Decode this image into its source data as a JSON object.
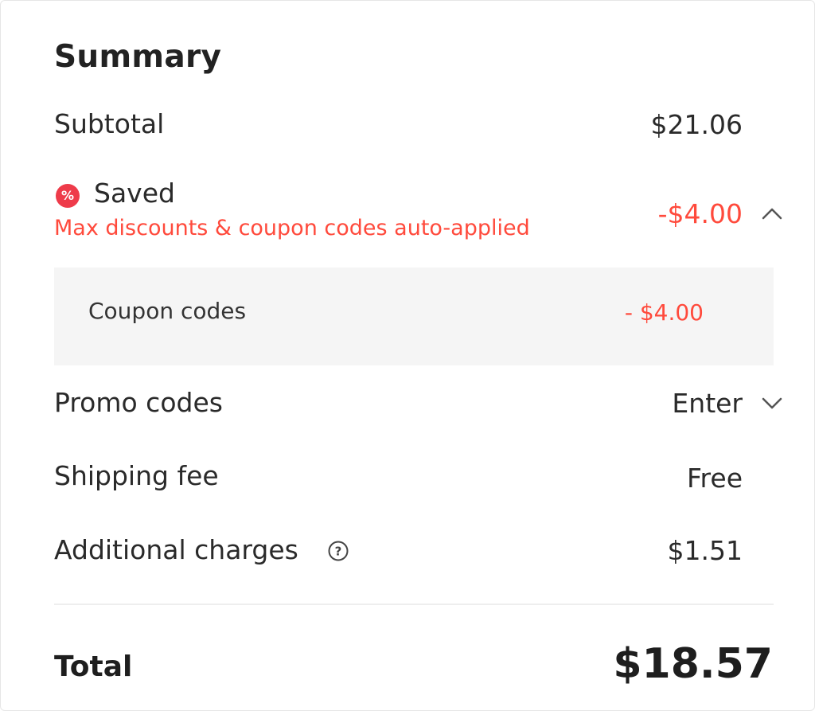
{
  "summary": {
    "title": "Summary",
    "subtotal": {
      "label": "Subtotal",
      "value": "$21.06"
    },
    "saved": {
      "label": "Saved",
      "icon": "percent-badge-icon",
      "icon_glyph": "%",
      "description": "Max discounts & coupon codes auto-applied",
      "value": "-$4.00",
      "expanded": true,
      "color": "#ff4a3c"
    },
    "coupon_codes": {
      "label": "Coupon codes",
      "value": "- $4.00"
    },
    "promo_codes": {
      "label": "Promo codes",
      "action": "Enter"
    },
    "shipping_fee": {
      "label": "Shipping fee",
      "value": "Free"
    },
    "additional_charges": {
      "label": "Additional charges",
      "value": "$1.51",
      "icon": "help-icon"
    },
    "total": {
      "label": "Total",
      "value": "$18.57"
    }
  }
}
